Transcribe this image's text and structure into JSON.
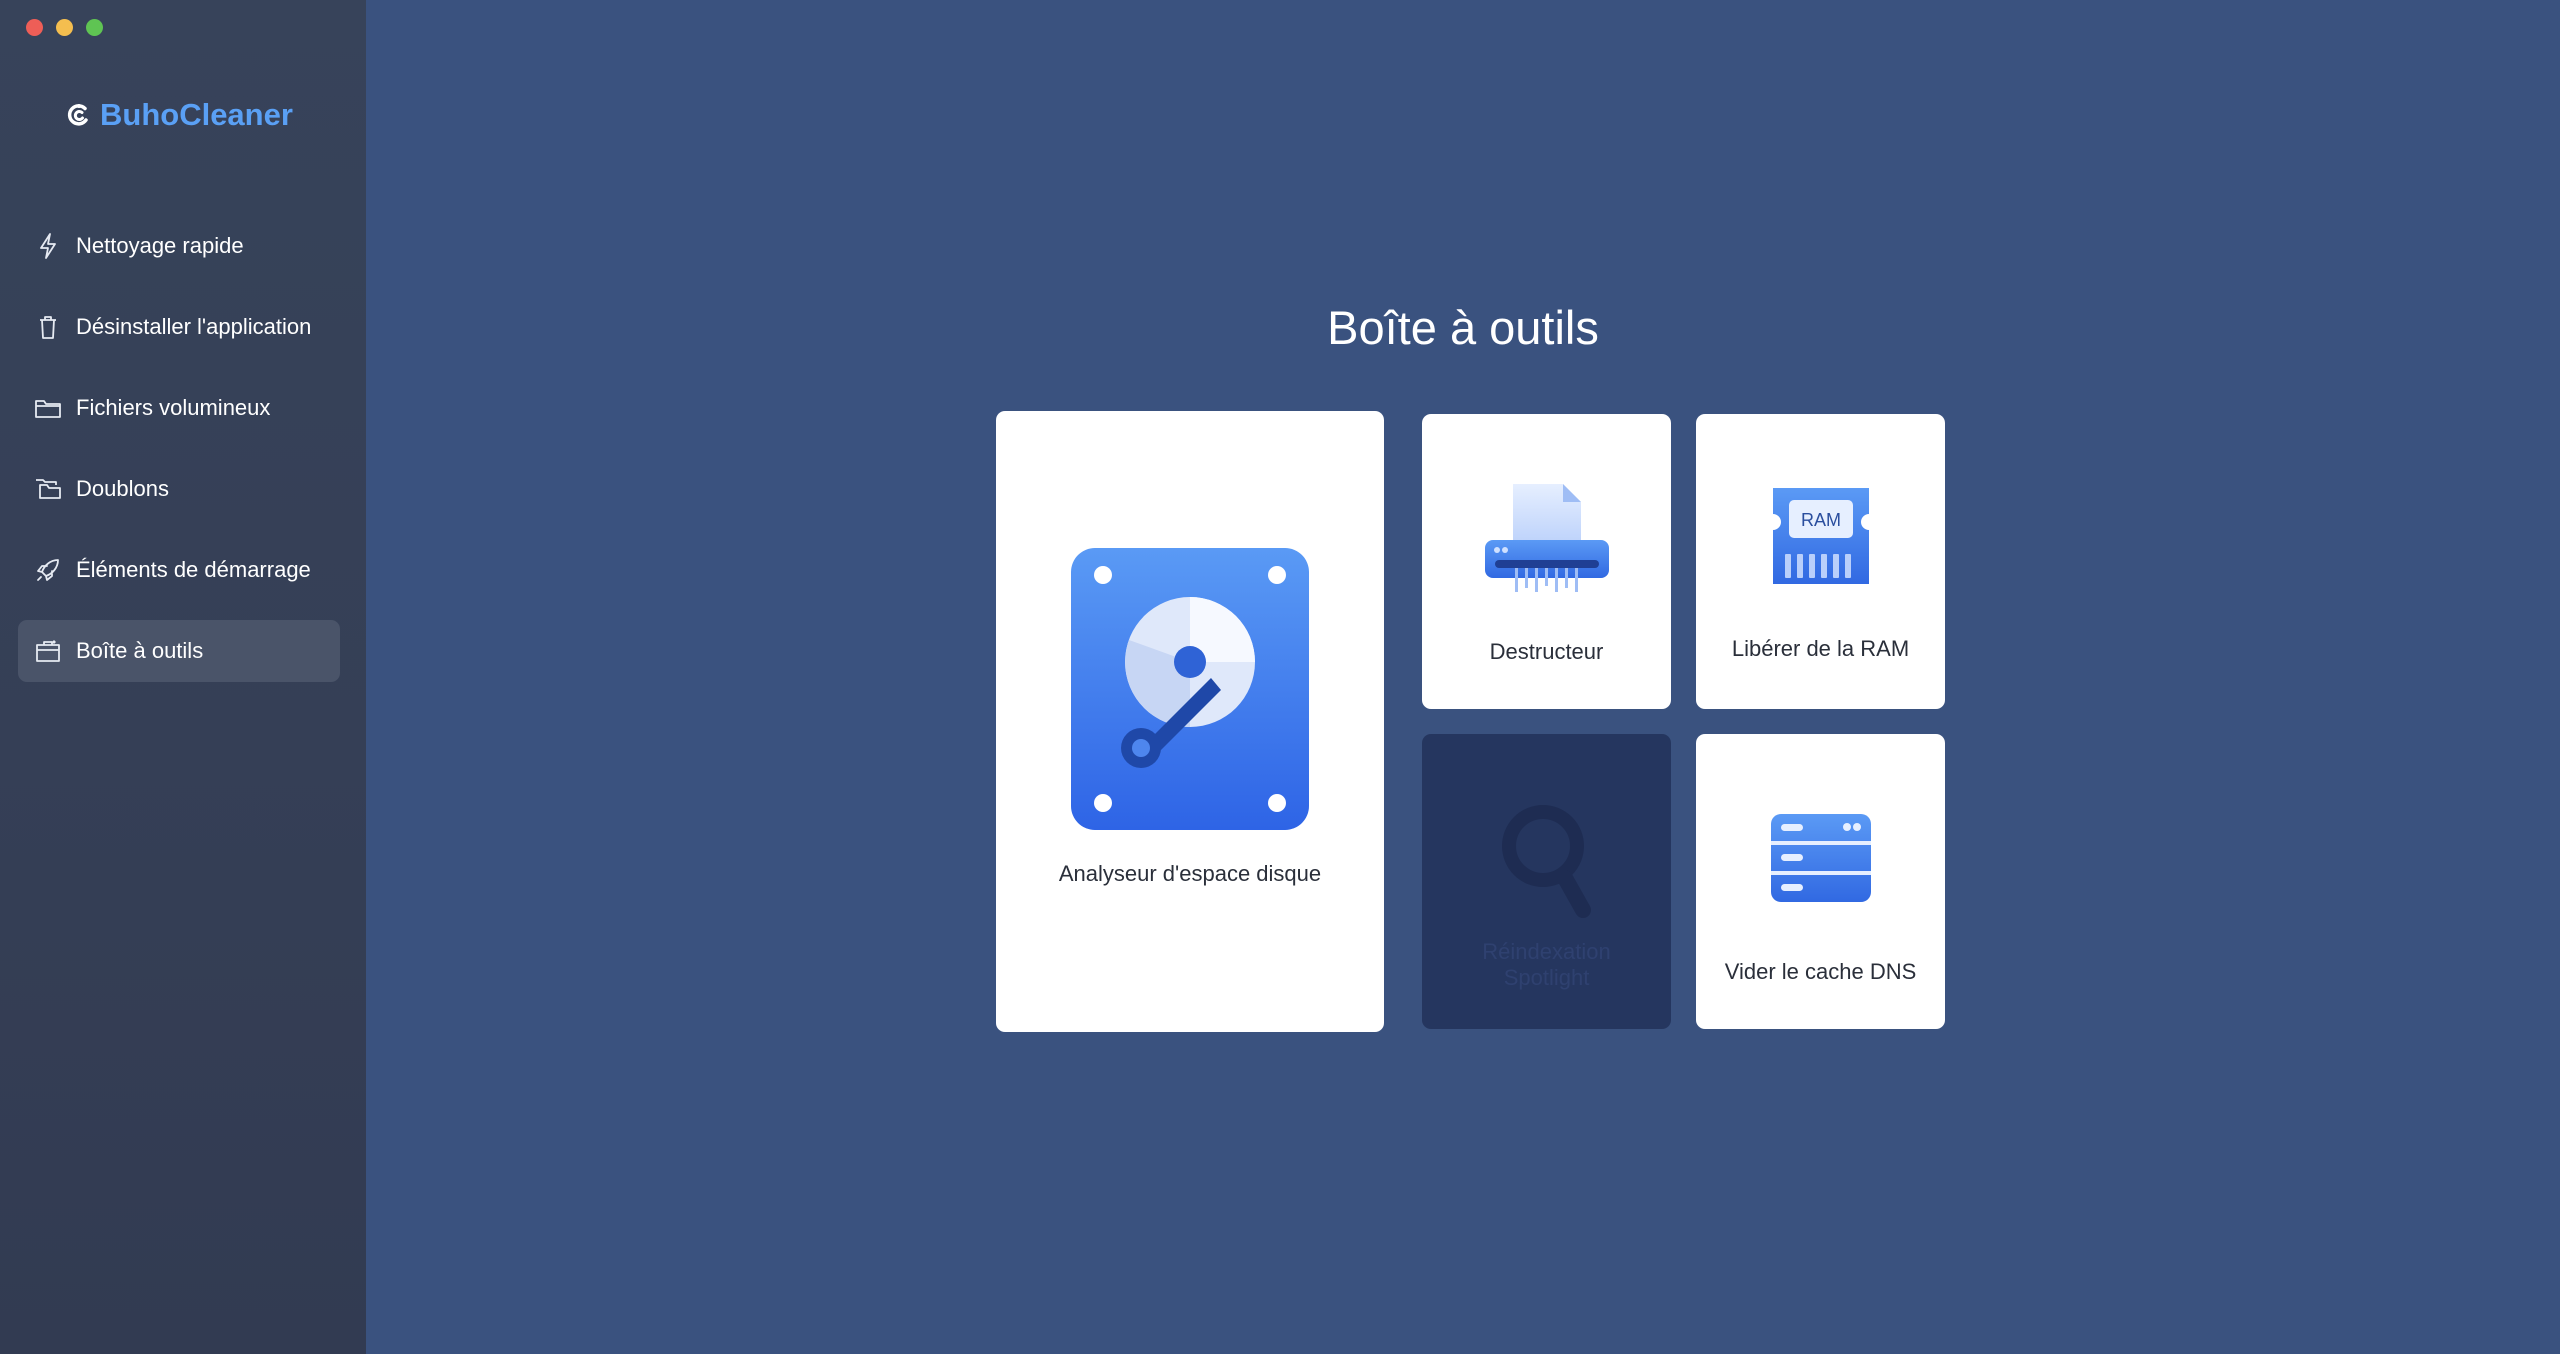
{
  "app": {
    "name": "BuhoCleaner",
    "brand_color": "#5aa0f5"
  },
  "window": {
    "traffic_lights": [
      "close",
      "minimize",
      "zoom"
    ]
  },
  "sidebar": {
    "items": [
      {
        "label": "Nettoyage rapide",
        "icon": "lightning-icon",
        "active": false
      },
      {
        "label": "Désinstaller l'application",
        "icon": "trash-icon",
        "active": false
      },
      {
        "label": "Fichiers volumineux",
        "icon": "folder-icon",
        "active": false
      },
      {
        "label": "Doublons",
        "icon": "duplicate-folder-icon",
        "active": false
      },
      {
        "label": "Éléments de démarrage",
        "icon": "rocket-icon",
        "active": false
      },
      {
        "label": "Boîte à outils",
        "icon": "toolbox-icon",
        "active": true
      }
    ]
  },
  "main": {
    "title": "Boîte à outils",
    "tools": [
      {
        "label": "Analyseur d'espace disque",
        "icon": "disk-analyzer-icon",
        "enabled": true
      },
      {
        "label": "Destructeur",
        "icon": "shredder-icon",
        "enabled": true
      },
      {
        "label": "Libérer de la RAM",
        "icon": "ram-icon",
        "ram_text": "RAM",
        "enabled": true
      },
      {
        "label": "Réindexation Spotlight",
        "icon": "magnifier-icon",
        "enabled": false
      },
      {
        "label": "Vider le cache DNS",
        "icon": "dns-server-icon",
        "enabled": true
      }
    ]
  }
}
